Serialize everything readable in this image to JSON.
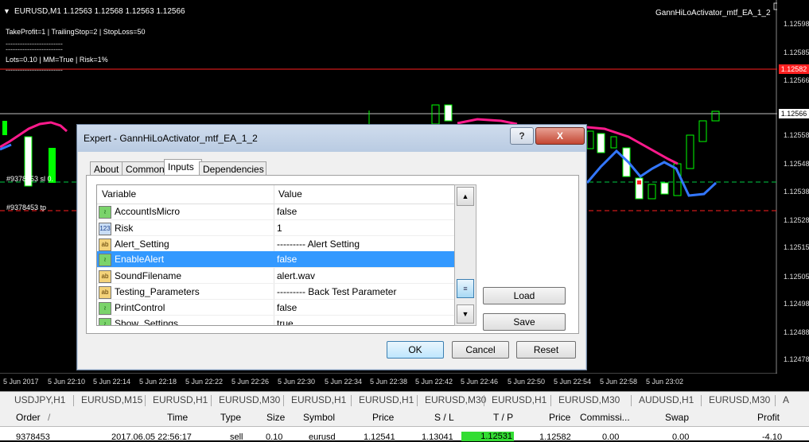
{
  "chart": {
    "header": "EURUSD,M1  1.12563 1.12568 1.12563 1.12566",
    "ea_label": "GannHiLoActivator_mtf_EA_1_2",
    "info_line1": "TakeProfit=1 | TrailingStop=2 | StopLoss=50",
    "info_line2": "Lots=0.10 | MM=True | Risk=1%",
    "order_sl_label": "#9378453 sl 0.",
    "order_tp_label": "#9378453 tp",
    "y_ticks": [
      "1.12598",
      "1.12585",
      "1.12566",
      "1.12558",
      "1.12548",
      "1.12538",
      "1.12528",
      "1.12515",
      "1.12505",
      "1.12498",
      "1.12488",
      "1.12478"
    ],
    "red_price": "1.12582",
    "current_price": "1.12566",
    "x_ticks": [
      "5 Jun 2017",
      "5 Jun 22:10",
      "5 Jun 22:14",
      "5 Jun 22:18",
      "5 Jun 22:22",
      "5 Jun 22:26",
      "5 Jun 22:30",
      "5 Jun 22:34",
      "5 Jun 22:38",
      "5 Jun 22:42",
      "5 Jun 22:46",
      "5 Jun 22:50",
      "5 Jun 22:54",
      "5 Jun 22:58",
      "5 Jun 23:02"
    ],
    "colors": {
      "bull": "#00ff00",
      "line_pink": "#ff1a8c",
      "line_blue": "#3377ff",
      "red": "#ff2020"
    }
  },
  "symbol_tabs": [
    "USDJPY,H1",
    "EURUSD,M15",
    "EURUSD,H1",
    "EURUSD,M30",
    "EURUSD,H1",
    "EURUSD,H1",
    "EURUSD,M30",
    "EURUSD,H1",
    "EURUSD,M30",
    "AUDUSD,H1",
    "EURUSD,M30",
    "A"
  ],
  "terminal": {
    "headers": [
      "Order",
      "/",
      "Time",
      "Type",
      "Size",
      "Symbol",
      "Price",
      "S / L",
      "T / P",
      "Price",
      "Commissi...",
      "Swap",
      "Profit"
    ],
    "row": {
      "order": "9378453",
      "time": "2017.06.05 22:56:17",
      "type": "sell",
      "size": "0.10",
      "symbol": "eurusd",
      "price": "1.12541",
      "sl": "1.13041",
      "tp": "1.12531",
      "price2": "1.12582",
      "commission": "0.00",
      "swap": "0.00",
      "profit": "-4.10"
    }
  },
  "dialog": {
    "title": "Expert - GannHiLoActivator_mtf_EA_1_2",
    "help_label": "?",
    "close_label": "X",
    "tabs": [
      "About",
      "Common",
      "Inputs",
      "Dependencies"
    ],
    "active_tab": "Inputs",
    "col_variable": "Variable",
    "col_value": "Value",
    "rows": [
      {
        "icon": "bool",
        "name": "AccountIsMicro",
        "value": "false"
      },
      {
        "icon": "int",
        "name": "Risk",
        "value": "1"
      },
      {
        "icon": "str",
        "name": "Alert_Setting",
        "value": "--------- Alert Setting"
      },
      {
        "icon": "bool",
        "name": "EnableAlert",
        "value": "false"
      },
      {
        "icon": "str",
        "name": "SoundFilename",
        "value": "alert.wav"
      },
      {
        "icon": "str",
        "name": "Testing_Parameters",
        "value": "--------- Back Test Parameter"
      },
      {
        "icon": "bool",
        "name": "PrintControl",
        "value": "false"
      },
      {
        "icon": "bool",
        "name": "Show_Settings",
        "value": "true"
      }
    ],
    "selected_row": 3,
    "icon_text": {
      "int": "123",
      "str": "ab"
    },
    "load_label": "Load",
    "save_label": "Save",
    "ok_label": "OK",
    "cancel_label": "Cancel",
    "reset_label": "Reset"
  }
}
